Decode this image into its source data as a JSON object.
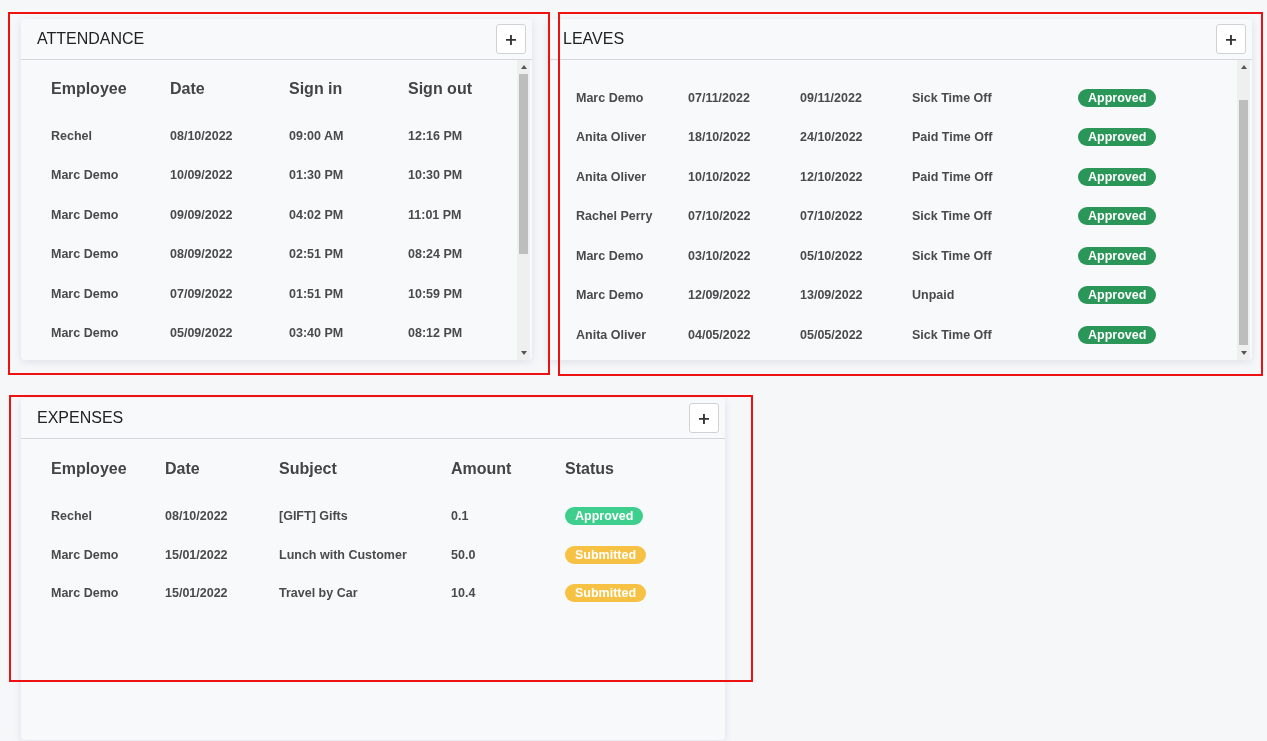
{
  "attendance": {
    "title": "ATTENDANCE",
    "add_button": "+",
    "columns": [
      "Employee",
      "Date",
      "Sign in",
      "Sign out"
    ],
    "rows": [
      [
        "Rechel",
        "08/10/2022",
        "09:00 AM",
        "12:16 PM"
      ],
      [
        "Marc Demo",
        "10/09/2022",
        "01:30 PM",
        "10:30 PM"
      ],
      [
        "Marc Demo",
        "09/09/2022",
        "04:02 PM",
        "11:01 PM"
      ],
      [
        "Marc Demo",
        "08/09/2022",
        "02:51 PM",
        "08:24 PM"
      ],
      [
        "Marc Demo",
        "07/09/2022",
        "01:51 PM",
        "10:59 PM"
      ],
      [
        "Marc Demo",
        "05/09/2022",
        "03:40 PM",
        "08:12 PM"
      ]
    ]
  },
  "leaves": {
    "title": "LEAVES",
    "add_button": "+",
    "rows": [
      {
        "cells": [
          "Marc Demo",
          "07/11/2022",
          "09/11/2022",
          "Sick Time Off"
        ],
        "status": {
          "label": "Approved",
          "color": "#2a9758"
        }
      },
      {
        "cells": [
          "Anita Oliver",
          "18/10/2022",
          "24/10/2022",
          "Paid Time Off"
        ],
        "status": {
          "label": "Approved",
          "color": "#2a9758"
        }
      },
      {
        "cells": [
          "Anita Oliver",
          "10/10/2022",
          "12/10/2022",
          "Paid Time Off"
        ],
        "status": {
          "label": "Approved",
          "color": "#2a9758"
        }
      },
      {
        "cells": [
          "Rachel Perry",
          "07/10/2022",
          "07/10/2022",
          "Sick Time Off"
        ],
        "status": {
          "label": "Approved",
          "color": "#2a9758"
        }
      },
      {
        "cells": [
          "Marc Demo",
          "03/10/2022",
          "05/10/2022",
          "Sick Time Off"
        ],
        "status": {
          "label": "Approved",
          "color": "#2a9758"
        }
      },
      {
        "cells": [
          "Marc Demo",
          "12/09/2022",
          "13/09/2022",
          "Unpaid"
        ],
        "status": {
          "label": "Approved",
          "color": "#2a9758"
        }
      },
      {
        "cells": [
          "Anita Oliver",
          "04/05/2022",
          "05/05/2022",
          "Sick Time Off"
        ],
        "status": {
          "label": "Approved",
          "color": "#2a9758"
        }
      }
    ]
  },
  "expenses": {
    "title": "EXPENSES",
    "add_button": "+",
    "columns": [
      "Employee",
      "Date",
      "Subject",
      "Amount",
      "Status"
    ],
    "rows": [
      {
        "cells": [
          "Rechel",
          "08/10/2022",
          "[GIFT] Gifts",
          "0.1"
        ],
        "status": {
          "label": "Approved",
          "color": "#3ecf8e"
        }
      },
      {
        "cells": [
          "Marc Demo",
          "15/01/2022",
          "Lunch with Customer",
          "50.0"
        ],
        "status": {
          "label": "Submitted",
          "color": "#f7c244"
        }
      },
      {
        "cells": [
          "Marc Demo",
          "15/01/2022",
          "Travel by Car",
          "10.4"
        ],
        "status": {
          "label": "Submitted",
          "color": "#f7c244"
        }
      }
    ]
  }
}
